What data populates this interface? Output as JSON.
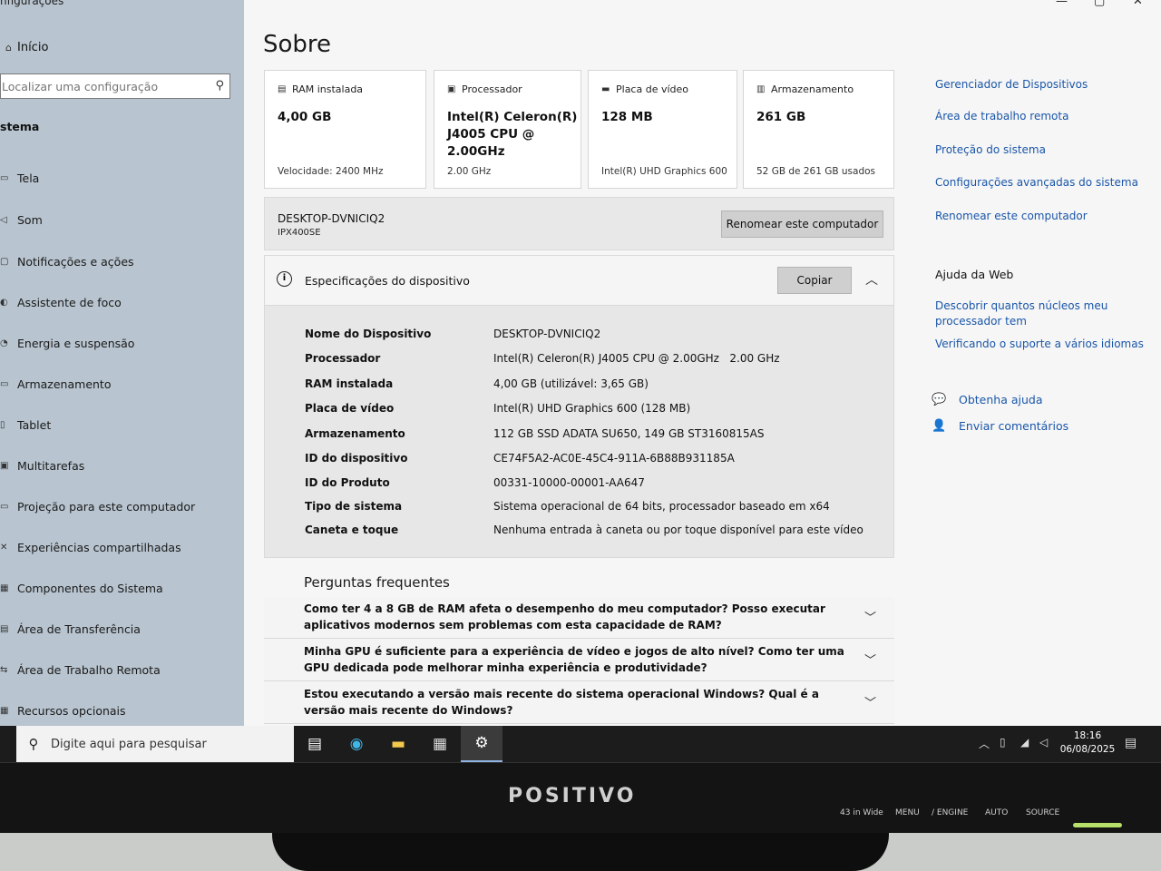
{
  "sidebar": {
    "app_title": "nfigurações",
    "home": "Início",
    "search_placeholder": "Localizar uma configuração",
    "section": "stema",
    "items": [
      {
        "label": "Tela",
        "icon": "display-icon"
      },
      {
        "label": "Som",
        "icon": "speaker-icon"
      },
      {
        "label": "Notificações e ações",
        "icon": "notification-icon"
      },
      {
        "label": "Assistente de foco",
        "icon": "moon-icon"
      },
      {
        "label": "Energia e suspensão",
        "icon": "power-icon"
      },
      {
        "label": "Armazenamento",
        "icon": "storage-icon"
      },
      {
        "label": "Tablet",
        "icon": "tablet-icon"
      },
      {
        "label": "Multitarefas",
        "icon": "multitask-icon"
      },
      {
        "label": "Projeção para este computador",
        "icon": "projection-icon"
      },
      {
        "label": "Experiências compartilhadas",
        "icon": "share-icon"
      },
      {
        "label": "Componentes do Sistema",
        "icon": "components-icon"
      },
      {
        "label": "Área de Transferência",
        "icon": "clipboard-icon"
      },
      {
        "label": "Área de Trabalho Remota",
        "icon": "remote-icon"
      },
      {
        "label": "Recursos opcionais",
        "icon": "optional-icon"
      }
    ]
  },
  "main": {
    "title": "Sobre",
    "cards": [
      {
        "label": "RAM instalada",
        "value": "4,00 GB",
        "sub": "Velocidade: 2400 MHz"
      },
      {
        "label": "Processador",
        "value": "Intel(R) Celeron(R) J4005 CPU @ 2.00GHz",
        "sub": "2.00 GHz"
      },
      {
        "label": "Placa de vídeo",
        "value": "128 MB",
        "sub": "Intel(R) UHD Graphics 600"
      },
      {
        "label": "Armazenamento",
        "value": "261 GB",
        "sub": "52 GB de 261 GB usados"
      }
    ],
    "device": {
      "name": "DESKTOP-DVNICIQ2",
      "model": "IPX400SE",
      "rename_button": "Renomear este computador"
    },
    "specs": {
      "title": "Especificações do dispositivo",
      "copy_button": "Copiar",
      "rows": [
        {
          "key": "Nome do Dispositivo",
          "value": "DESKTOP-DVNICIQ2"
        },
        {
          "key": "Processador",
          "value": "Intel(R) Celeron(R) J4005 CPU @ 2.00GHz   2.00 GHz"
        },
        {
          "key": "RAM instalada",
          "value": "4,00 GB (utilizável: 3,65 GB)"
        },
        {
          "key": "Placa de vídeo",
          "value": "Intel(R) UHD Graphics 600 (128 MB)"
        },
        {
          "key": "Armazenamento",
          "value": "112 GB SSD ADATA SU650, 149 GB ST3160815AS"
        },
        {
          "key": "ID do dispositivo",
          "value": "CE74F5A2-AC0E-45C4-911A-6B88B931185A"
        },
        {
          "key": "ID do Produto",
          "value": "00331-10000-00001-AA647"
        },
        {
          "key": "Tipo de sistema",
          "value": "Sistema operacional de 64 bits, processador baseado em x64"
        },
        {
          "key": "Caneta e toque",
          "value": "Nenhuma entrada à caneta ou por toque disponível para este vídeo"
        }
      ]
    },
    "faq": {
      "title": "Perguntas frequentes",
      "items": [
        "Como ter 4 a 8 GB de RAM afeta o desempenho do meu computador? Posso executar aplicativos modernos sem problemas com esta capacidade de RAM?",
        "Minha GPU é suficiente para a experiência de vídeo e jogos de alto nível? Como ter uma GPU dedicada pode melhorar minha experiência e produtividade?",
        "Estou executando a versão mais recente do sistema operacional Windows? Qual é a versão mais recente do Windows?"
      ]
    }
  },
  "related": {
    "links": [
      "Gerenciador de Dispositivos",
      "Área de trabalho remota",
      "Proteção do sistema",
      "Configurações avançadas do sistema",
      "Renomear este computador"
    ],
    "web_help_title": "Ajuda da Web",
    "web_links": [
      "Descobrir quantos núcleos meu processador tem",
      "Verificando o suporte a vários idiomas"
    ],
    "get_help": "Obtenha ajuda",
    "feedback": "Enviar comentários"
  },
  "taskbar": {
    "search_placeholder": "Digite aqui para pesquisar",
    "time": "18:16",
    "date": "06/08/2025"
  },
  "bezel": {
    "brand": "POSITIVO",
    "size": "43 in Wide",
    "buttons": [
      "MENU",
      "/ ENGINE",
      "AUTO",
      "SOURCE"
    ]
  }
}
